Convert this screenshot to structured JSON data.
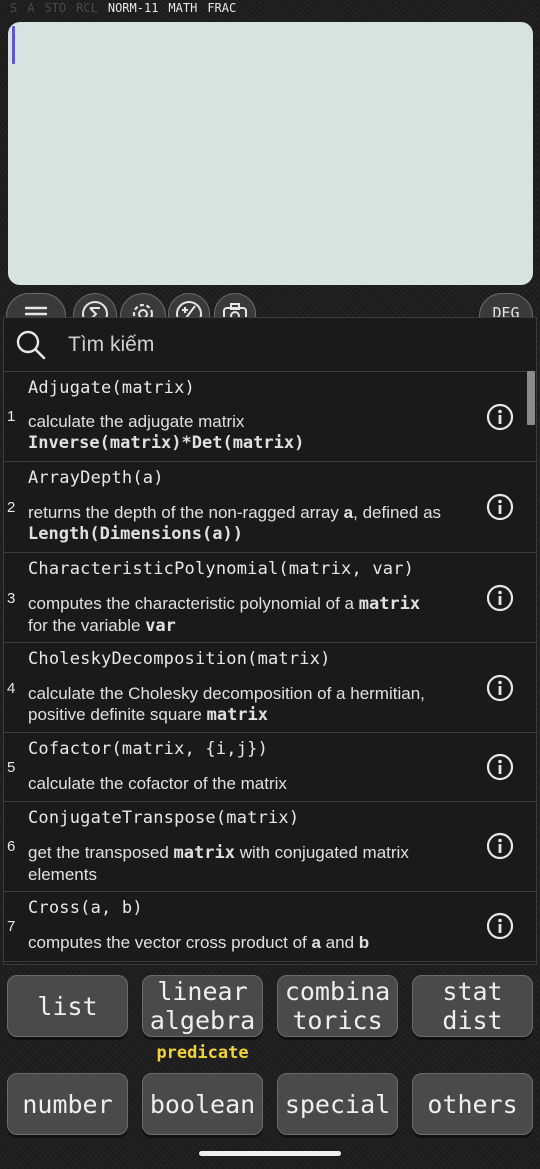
{
  "status": {
    "dim": [
      "S",
      "A",
      "STO",
      "RCL"
    ],
    "active": [
      "NORM-11",
      "MATH",
      "FRAC"
    ]
  },
  "toolbar": {
    "buttons": [
      "menu-icon",
      "sigma-icon",
      "gear-icon",
      "plus-minus-icon",
      "camera-icon"
    ],
    "angle_mode": "DEG"
  },
  "search": {
    "placeholder": "Tìm kiếm"
  },
  "functions": [
    {
      "num": "1",
      "signature": "Adjugate(matrix)",
      "desc_html": "calculate the adjugate matrix<br><span class=\"code\">Inverse(matrix)*Det(matrix)</span>"
    },
    {
      "num": "2",
      "signature": "ArrayDepth(a)",
      "desc_html": "returns the depth of the non-ragged array <span class=\"b\">a</span>, defined as<br><span class=\"code\">Length(Dimensions(a))</span>"
    },
    {
      "num": "3",
      "signature": "CharacteristicPolynomial(matrix, var)",
      "desc_html": "computes the characteristic polynomial of a <span class=\"code\">matrix</span><br>for the variable <span class=\"code\">var</span>"
    },
    {
      "num": "4",
      "signature": "CholeskyDecomposition(matrix)",
      "desc_html": "calculate the Cholesky decomposition of a hermitian,<br>positive definite square <span class=\"code\">matrix</span>"
    },
    {
      "num": "5",
      "signature": "Cofactor(matrix, {i,j})",
      "desc_html": "calculate the cofactor of the matrix"
    },
    {
      "num": "6",
      "signature": "ConjugateTranspose(matrix)",
      "desc_html": "get the transposed <span class=\"code\">matrix</span> with conjugated matrix<br>elements"
    },
    {
      "num": "7",
      "signature": "Cross(a, b)",
      "desc_html": "computes the vector cross product of <span class=\"b\">a</span> and <span class=\"b\">b</span>"
    }
  ],
  "categories": {
    "list": "list",
    "linear_algebra": "linear\nalgebra",
    "combinatorics": "combina\ntorics",
    "stat_dist": "stat\ndist",
    "number": "number",
    "boolean": "boolean",
    "special": "special",
    "others": "others",
    "boolean_sub": "predicate"
  }
}
